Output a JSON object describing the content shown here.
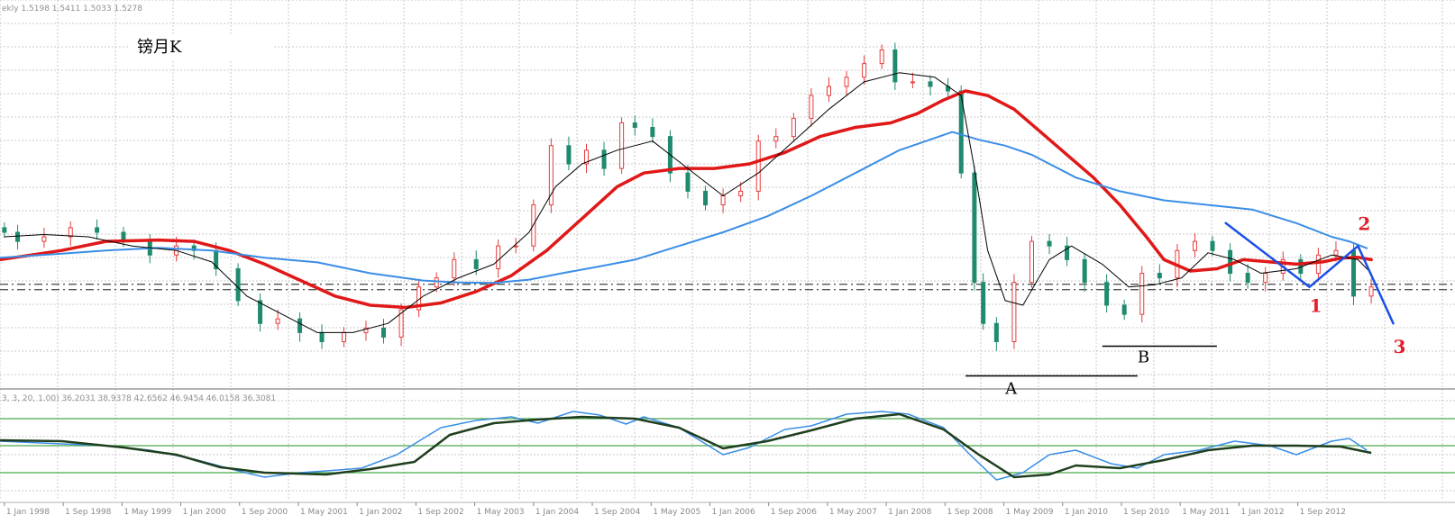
{
  "header": {
    "symbol_info": "ekly  1.5198 1.5411 1.5033 1.5278",
    "title": "镑月K",
    "oscillator_info": "3, 3, 20, 1.00) 36.2031 38.9378 42.6562 46.9454 46.0158 36.3081"
  },
  "chart_data": {
    "type": "line",
    "title": "镑月K",
    "x_ticks": [
      "1 Jan 1998",
      "1 Sep 1998",
      "1 May 1999",
      "1 Jan 2000",
      "1 Sep 2000",
      "1 May 2001",
      "1 Jan 2002",
      "1 Sep 2002",
      "1 May 2003",
      "1 Jan 2004",
      "1 Sep 2004",
      "1 May 2005",
      "1 Jan 2006",
      "1 Sep 2006",
      "1 May 2007",
      "1 Jan 2008",
      "1 Sep 2008",
      "1 May 2009",
      "1 Jan 2010",
      "1 Sep 2010",
      "1 May 2011",
      "1 Jan 2012",
      "1 Sep 2012"
    ],
    "x_range": [
      1997.8,
      2014.3
    ],
    "ylim": [
      1.34,
      2.13
    ],
    "reference_level": 1.54,
    "price_close": [
      [
        1997.85,
        1.66
      ],
      [
        1998.0,
        1.64
      ],
      [
        1998.3,
        1.65
      ],
      [
        1998.6,
        1.67
      ],
      [
        1998.9,
        1.66
      ],
      [
        1999.2,
        1.64
      ],
      [
        1999.5,
        1.61
      ],
      [
        1999.8,
        1.63
      ],
      [
        2000.0,
        1.62
      ],
      [
        2000.25,
        1.58
      ],
      [
        2000.5,
        1.51
      ],
      [
        2000.75,
        1.46
      ],
      [
        2000.95,
        1.47
      ],
      [
        2001.2,
        1.44
      ],
      [
        2001.45,
        1.42
      ],
      [
        2001.7,
        1.44
      ],
      [
        2001.95,
        1.45
      ],
      [
        2002.15,
        1.43
      ],
      [
        2002.35,
        1.49
      ],
      [
        2002.55,
        1.54
      ],
      [
        2002.75,
        1.56
      ],
      [
        2002.95,
        1.6
      ],
      [
        2003.2,
        1.58
      ],
      [
        2003.45,
        1.63
      ],
      [
        2003.65,
        1.63
      ],
      [
        2003.85,
        1.72
      ],
      [
        2004.05,
        1.85
      ],
      [
        2004.25,
        1.81
      ],
      [
        2004.45,
        1.84
      ],
      [
        2004.65,
        1.8
      ],
      [
        2004.85,
        1.9
      ],
      [
        2005.0,
        1.89
      ],
      [
        2005.2,
        1.87
      ],
      [
        2005.4,
        1.79
      ],
      [
        2005.6,
        1.75
      ],
      [
        2005.8,
        1.72
      ],
      [
        2006.0,
        1.74
      ],
      [
        2006.2,
        1.75
      ],
      [
        2006.4,
        1.86
      ],
      [
        2006.6,
        1.87
      ],
      [
        2006.8,
        1.91
      ],
      [
        2007.0,
        1.96
      ],
      [
        2007.2,
        1.98
      ],
      [
        2007.4,
        2.0
      ],
      [
        2007.6,
        2.03
      ],
      [
        2007.8,
        2.06
      ],
      [
        2007.95,
        1.99
      ],
      [
        2008.15,
        1.99
      ],
      [
        2008.35,
        1.98
      ],
      [
        2008.55,
        1.97
      ],
      [
        2008.7,
        1.79
      ],
      [
        2008.85,
        1.55
      ],
      [
        2008.95,
        1.46
      ],
      [
        2009.1,
        1.42
      ],
      [
        2009.3,
        1.55
      ],
      [
        2009.5,
        1.64
      ],
      [
        2009.7,
        1.63
      ],
      [
        2009.9,
        1.6
      ],
      [
        2010.1,
        1.55
      ],
      [
        2010.35,
        1.5
      ],
      [
        2010.55,
        1.48
      ],
      [
        2010.75,
        1.57
      ],
      [
        2010.95,
        1.56
      ],
      [
        2011.15,
        1.62
      ],
      [
        2011.35,
        1.64
      ],
      [
        2011.55,
        1.62
      ],
      [
        2011.75,
        1.57
      ],
      [
        2011.95,
        1.55
      ],
      [
        2012.15,
        1.57
      ],
      [
        2012.35,
        1.6
      ],
      [
        2012.55,
        1.57
      ],
      [
        2012.75,
        1.61
      ],
      [
        2012.95,
        1.62
      ],
      [
        2013.15,
        1.52
      ],
      [
        2013.35,
        1.54
      ]
    ],
    "series": [
      {
        "name": "",
        "color": "#e01818",
        "points": [
          [
            1997.8,
            1.6
          ],
          [
            1998.5,
            1.62
          ],
          [
            1999.0,
            1.64
          ],
          [
            1999.6,
            1.643
          ],
          [
            2000.0,
            1.64
          ],
          [
            2000.4,
            1.62
          ],
          [
            2000.8,
            1.59
          ],
          [
            2001.2,
            1.555
          ],
          [
            2001.6,
            1.52
          ],
          [
            2002.0,
            1.5
          ],
          [
            2002.4,
            1.495
          ],
          [
            2002.8,
            1.505
          ],
          [
            2003.2,
            1.53
          ],
          [
            2003.6,
            1.565
          ],
          [
            2004.0,
            1.62
          ],
          [
            2004.4,
            1.69
          ],
          [
            2004.8,
            1.76
          ],
          [
            2005.1,
            1.79
          ],
          [
            2005.5,
            1.8
          ],
          [
            2005.9,
            1.8
          ],
          [
            2006.3,
            1.81
          ],
          [
            2006.7,
            1.835
          ],
          [
            2007.1,
            1.87
          ],
          [
            2007.5,
            1.89
          ],
          [
            2007.9,
            1.9
          ],
          [
            2008.2,
            1.92
          ],
          [
            2008.5,
            1.95
          ],
          [
            2008.75,
            1.97
          ],
          [
            2009.0,
            1.96
          ],
          [
            2009.3,
            1.93
          ],
          [
            2009.6,
            1.88
          ],
          [
            2009.9,
            1.83
          ],
          [
            2010.2,
            1.78
          ],
          [
            2010.5,
            1.72
          ],
          [
            2010.8,
            1.65
          ],
          [
            2011.0,
            1.6
          ],
          [
            2011.3,
            1.575
          ],
          [
            2011.6,
            1.58
          ],
          [
            2011.9,
            1.6
          ],
          [
            2012.2,
            1.595
          ],
          [
            2012.5,
            1.59
          ],
          [
            2012.8,
            1.595
          ],
          [
            2013.0,
            1.603
          ],
          [
            2013.2,
            1.605
          ],
          [
            2013.35,
            1.6
          ]
        ]
      },
      {
        "name": "",
        "color": "#3a8ee6",
        "points": [
          [
            1997.8,
            1.604
          ],
          [
            1998.5,
            1.613
          ],
          [
            1999.0,
            1.62
          ],
          [
            1999.6,
            1.626
          ],
          [
            2000.2,
            1.62
          ],
          [
            2000.8,
            1.604
          ],
          [
            2001.4,
            1.594
          ],
          [
            2002.0,
            1.57
          ],
          [
            2002.6,
            1.554
          ],
          [
            2003.0,
            1.55
          ],
          [
            2003.4,
            1.549
          ],
          [
            2003.8,
            1.556
          ],
          [
            2004.2,
            1.571
          ],
          [
            2004.6,
            1.585
          ],
          [
            2005.0,
            1.6
          ],
          [
            2005.5,
            1.63
          ],
          [
            2006.0,
            1.66
          ],
          [
            2006.5,
            1.695
          ],
          [
            2007.0,
            1.74
          ],
          [
            2007.5,
            1.79
          ],
          [
            2008.0,
            1.84
          ],
          [
            2008.3,
            1.86
          ],
          [
            2008.6,
            1.88
          ],
          [
            2008.9,
            1.863
          ],
          [
            2009.2,
            1.85
          ],
          [
            2009.5,
            1.83
          ],
          [
            2010.0,
            1.78
          ],
          [
            2010.5,
            1.75
          ],
          [
            2011.0,
            1.73
          ],
          [
            2011.5,
            1.72
          ],
          [
            2012.0,
            1.71
          ],
          [
            2012.5,
            1.68
          ],
          [
            2012.9,
            1.65
          ],
          [
            2013.1,
            1.64
          ],
          [
            2013.3,
            1.625
          ]
        ]
      },
      {
        "name": "",
        "color": "#000000",
        "points": [
          [
            1997.85,
            1.65
          ],
          [
            1998.3,
            1.655
          ],
          [
            1998.8,
            1.65
          ],
          [
            1999.3,
            1.63
          ],
          [
            1999.8,
            1.62
          ],
          [
            2000.2,
            1.595
          ],
          [
            2000.6,
            1.52
          ],
          [
            2001.0,
            1.48
          ],
          [
            2001.4,
            1.44
          ],
          [
            2001.8,
            1.44
          ],
          [
            2002.2,
            1.46
          ],
          [
            2002.6,
            1.52
          ],
          [
            2003.0,
            1.56
          ],
          [
            2003.4,
            1.59
          ],
          [
            2003.8,
            1.66
          ],
          [
            2004.1,
            1.76
          ],
          [
            2004.4,
            1.81
          ],
          [
            2004.8,
            1.84
          ],
          [
            2005.2,
            1.86
          ],
          [
            2005.6,
            1.8
          ],
          [
            2006.0,
            1.74
          ],
          [
            2006.4,
            1.79
          ],
          [
            2006.8,
            1.86
          ],
          [
            2007.2,
            1.93
          ],
          [
            2007.6,
            1.99
          ],
          [
            2008.0,
            2.01
          ],
          [
            2008.4,
            2.0
          ],
          [
            2008.7,
            1.96
          ],
          [
            2008.85,
            1.8
          ],
          [
            2009.0,
            1.62
          ],
          [
            2009.2,
            1.51
          ],
          [
            2009.4,
            1.5
          ],
          [
            2009.7,
            1.6
          ],
          [
            2009.95,
            1.63
          ],
          [
            2010.3,
            1.59
          ],
          [
            2010.6,
            1.54
          ],
          [
            2010.9,
            1.545
          ],
          [
            2011.2,
            1.56
          ],
          [
            2011.5,
            1.615
          ],
          [
            2011.8,
            1.6
          ],
          [
            2012.1,
            1.57
          ],
          [
            2012.5,
            1.58
          ],
          [
            2012.9,
            1.61
          ],
          [
            2013.2,
            1.6
          ],
          [
            2013.35,
            1.57
          ]
        ]
      },
      {
        "name": "",
        "color": "#1a50e6",
        "points": [
          [
            2011.7,
            1.68
          ],
          [
            2012.65,
            1.54
          ],
          [
            2013.2,
            1.63
          ],
          [
            2013.6,
            1.46
          ]
        ]
      }
    ],
    "annotations": {
      "wave_labels": [
        "1",
        "2",
        "3"
      ],
      "support_labels": [
        "A",
        "B"
      ]
    },
    "oscillator": {
      "params": "3, 3, 20, 1.00",
      "levels": [
        20,
        50,
        80
      ],
      "series": [
        {
          "name": "",
          "color": "#3a8ee6",
          "points": [
            [
              1997.8,
              55
            ],
            [
              1998.5,
              52
            ],
            [
              1999.0,
              50
            ],
            [
              1999.5,
              45
            ],
            [
              2000.0,
              35
            ],
            [
              2000.5,
              22
            ],
            [
              2000.8,
              15
            ],
            [
              2001.2,
              20
            ],
            [
              2001.5,
              22
            ],
            [
              2001.9,
              25
            ],
            [
              2002.3,
              40
            ],
            [
              2002.8,
              70
            ],
            [
              2003.2,
              78
            ],
            [
              2003.6,
              82
            ],
            [
              2003.9,
              75
            ],
            [
              2004.3,
              88
            ],
            [
              2004.6,
              84
            ],
            [
              2004.9,
              74
            ],
            [
              2005.1,
              82
            ],
            [
              2005.5,
              70
            ],
            [
              2006.0,
              40
            ],
            [
              2006.3,
              48
            ],
            [
              2006.7,
              68
            ],
            [
              2007.0,
              72
            ],
            [
              2007.4,
              85
            ],
            [
              2007.8,
              88
            ],
            [
              2008.1,
              85
            ],
            [
              2008.5,
              70
            ],
            [
              2008.8,
              40
            ],
            [
              2009.1,
              12
            ],
            [
              2009.4,
              20
            ],
            [
              2009.7,
              40
            ],
            [
              2010.0,
              45
            ],
            [
              2010.4,
              30
            ],
            [
              2010.7,
              25
            ],
            [
              2011.0,
              40
            ],
            [
              2011.4,
              45
            ],
            [
              2011.8,
              55
            ],
            [
              2012.2,
              50
            ],
            [
              2012.5,
              40
            ],
            [
              2012.9,
              55
            ],
            [
              2013.1,
              58
            ],
            [
              2013.3,
              45
            ]
          ]
        },
        {
          "name": "",
          "color": "#1f3f1f",
          "points": [
            [
              1997.8,
              56
            ],
            [
              1998.5,
              55
            ],
            [
              1999.2,
              48
            ],
            [
              1999.8,
              40
            ],
            [
              2000.3,
              26
            ],
            [
              2000.8,
              20
            ],
            [
              2001.5,
              18
            ],
            [
              2002.0,
              24
            ],
            [
              2002.5,
              32
            ],
            [
              2002.9,
              62
            ],
            [
              2003.4,
              75
            ],
            [
              2003.9,
              79
            ],
            [
              2004.4,
              82
            ],
            [
              2005.0,
              80
            ],
            [
              2005.5,
              70
            ],
            [
              2006.0,
              47
            ],
            [
              2006.5,
              55
            ],
            [
              2007.0,
              67
            ],
            [
              2007.5,
              80
            ],
            [
              2008.0,
              85
            ],
            [
              2008.5,
              68
            ],
            [
              2008.9,
              40
            ],
            [
              2009.3,
              15
            ],
            [
              2009.7,
              18
            ],
            [
              2010.0,
              28
            ],
            [
              2010.5,
              25
            ],
            [
              2011.0,
              34
            ],
            [
              2011.5,
              45
            ],
            [
              2012.0,
              50
            ],
            [
              2012.5,
              50
            ],
            [
              2013.0,
              49
            ],
            [
              2013.35,
              42
            ]
          ]
        }
      ]
    }
  }
}
